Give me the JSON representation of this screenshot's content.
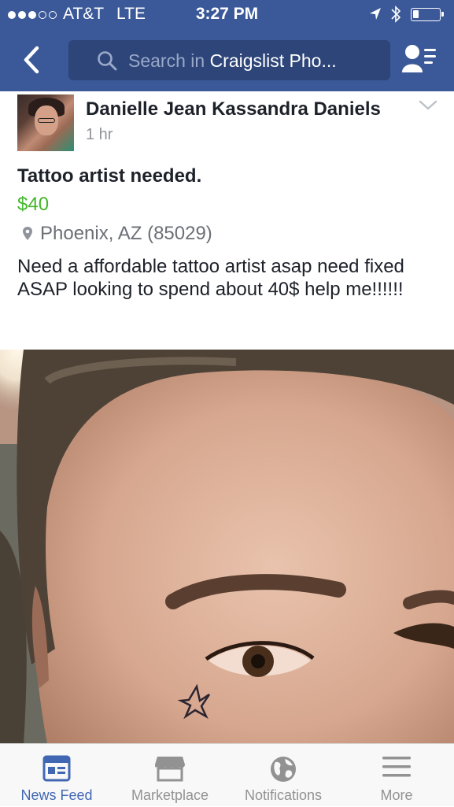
{
  "status_bar": {
    "carrier": "AT&T",
    "network": "LTE",
    "time": "3:27 PM",
    "signal_bars_filled": 3,
    "signal_bars_total": 5,
    "battery_level": 0.2,
    "icons": [
      "location-arrow-icon",
      "bluetooth-icon",
      "battery-icon"
    ]
  },
  "nav": {
    "back_icon": "chevron-left-icon",
    "search_prefix": "Search in ",
    "search_term": "Craigslist Pho...",
    "friends_icon": "friend-list-icon"
  },
  "post": {
    "author": "Danielle Jean Kassandra Daniels",
    "time": "1 hr",
    "title": "Tattoo artist needed.",
    "price": "$40",
    "location": "Phoenix, AZ (85029)",
    "description": "Need a affordable tattoo artist asap need fixed ASAP looking to spend about 40$ help me!!!!!!"
  },
  "tabs": [
    {
      "label": "News Feed",
      "icon": "news-feed-icon",
      "active": true
    },
    {
      "label": "Marketplace",
      "icon": "marketplace-icon",
      "active": false
    },
    {
      "label": "Notifications",
      "icon": "globe-icon",
      "active": false
    },
    {
      "label": "More",
      "icon": "hamburger-menu-icon",
      "active": false
    }
  ],
  "colors": {
    "header_blue": "#3b5998",
    "search_bg": "#2d4579",
    "price_green": "#42b72a",
    "tab_active": "#4267b2",
    "tab_inactive": "#929292"
  }
}
